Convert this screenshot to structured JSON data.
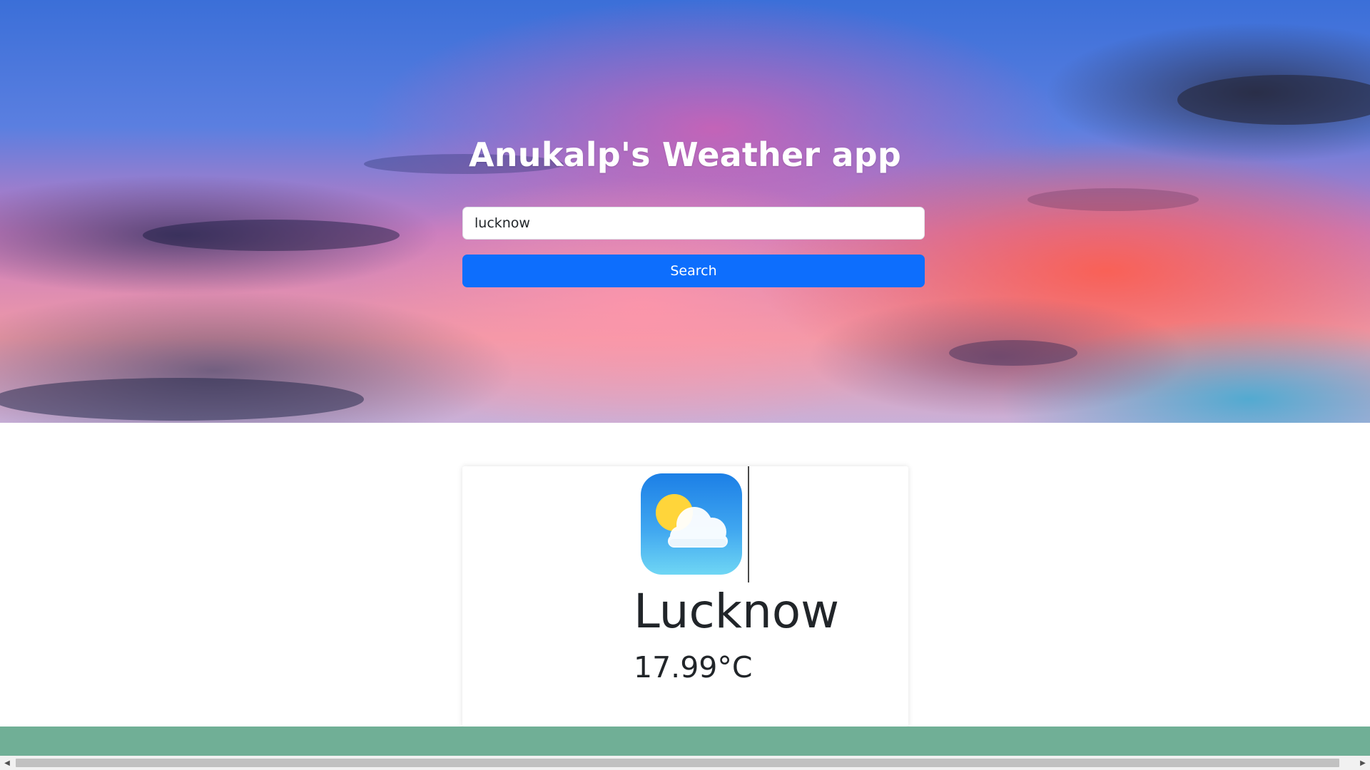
{
  "header": {
    "title": "Anukalp's Weather app"
  },
  "search": {
    "value": "lucknow",
    "button_label": "Search"
  },
  "weather": {
    "icon": "partly-cloudy-icon",
    "city": "Lucknow",
    "temperature": "17.99°C"
  },
  "colors": {
    "accent": "#0d6efd",
    "footer": "#70af96"
  },
  "scrollbar": {
    "left_arrow": "◀",
    "right_arrow": "▶"
  }
}
